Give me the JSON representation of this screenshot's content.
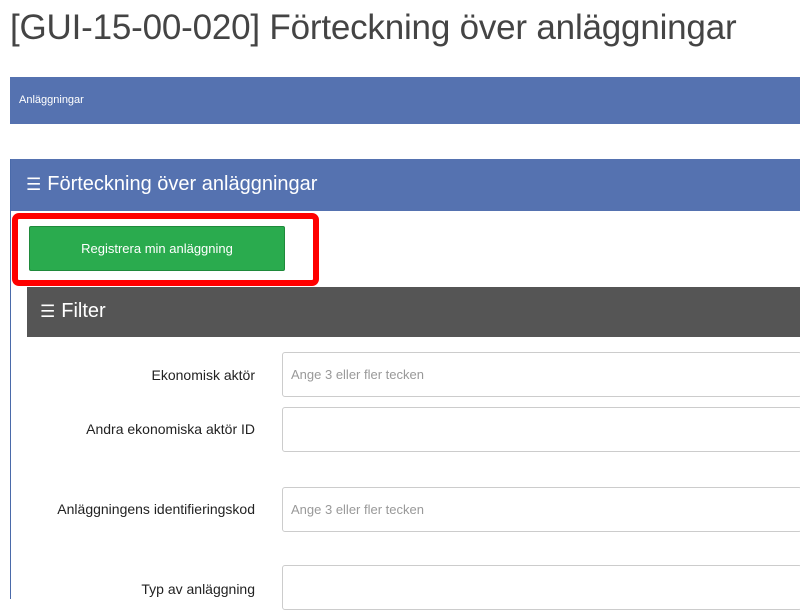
{
  "page_title": "[GUI-15-00-020] Förteckning över anläggningar",
  "breadcrumb": "Anläggningar",
  "panel": {
    "title": "Förteckning över anläggningar",
    "icon": "menu-icon"
  },
  "register_button": "Registrera min anläggning",
  "filter": {
    "title": "Filter",
    "fields": [
      {
        "label": "Ekonomisk aktör",
        "placeholder": "Ange 3 eller fler tecken",
        "value": ""
      },
      {
        "label": "Andra ekonomiska aktör ID",
        "placeholder": "",
        "value": ""
      },
      {
        "label": "Anläggningens identifieringskod",
        "placeholder": "Ange 3 eller fler tecken",
        "value": ""
      },
      {
        "label": "Typ av anläggning",
        "placeholder": "",
        "value": ""
      }
    ]
  },
  "colors": {
    "header_blue": "#5572b0",
    "filter_gray": "#555555",
    "button_green": "#2aab4e",
    "highlight_red": "#ff0000"
  }
}
